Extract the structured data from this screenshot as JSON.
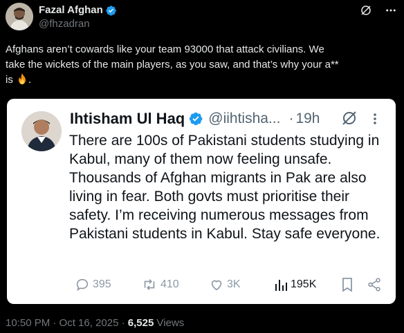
{
  "author": {
    "display_name": "Fazal Afghan",
    "handle": "@fhzadran"
  },
  "tweet": {
    "text_line1": "Afghans aren’t cowards like your team 93000 that attack civilians. We",
    "text_line2": "take the wickets of the main players, as you saw, and that’s why your a**",
    "text_line3": "is",
    "text_end": ".",
    "emoji": "fire-emoji"
  },
  "quoted": {
    "display_name": "Ihtisham Ul Haq",
    "handle": "@iihtisha...",
    "separator": "·",
    "time": "19h",
    "text": "There are 100s of Pakistani students studying in Kabul, many of them now feeling unsafe. Thousands of Afghan migrants in Pak are also living in fear. Both govts must prioritise their safety. I’m receiving numerous messages from Pakistani students in Kabul. Stay safe everyone.",
    "replies": "395",
    "reposts": "410",
    "likes": "3K",
    "views": "195K"
  },
  "footer": {
    "timestamp": "10:50 PM · Oct 16, 2025 · ",
    "views_count": "6,525",
    "views_label": " Views"
  },
  "colors": {
    "background": "#000000",
    "verified": "#1d9bf0",
    "card_bg": "#ffffff",
    "muted": "#71767b"
  }
}
